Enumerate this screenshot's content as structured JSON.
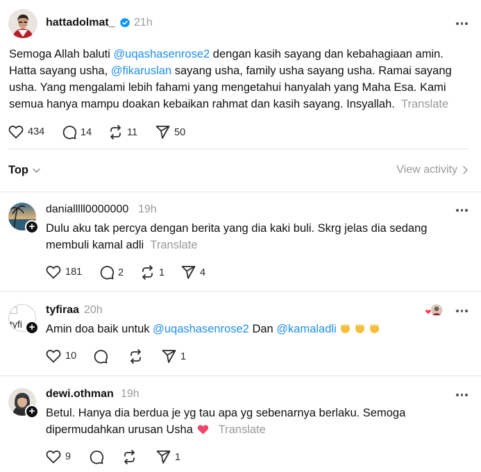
{
  "main_post": {
    "username": "hattadolmat_",
    "time": "21h",
    "text_a": "Semoga Allah baluti ",
    "mention_a": "@uqashasenrose2",
    "text_b": " dengan kasih sayang dan kebahagiaan amin.",
    "text_c": "Hatta sayang usha, ",
    "mention_b": "@fikaruslan",
    "text_d": " sayang usha, family usha sayang usha. Ramai sayang",
    "text_e": "usha. Yang mengalami lebih fahami yang mengetahui hanyalah yang Maha Esa. Kami",
    "text_f": "semua hanya mampu doakan kebaikan rahmat dan kasih sayang. Insyallah.",
    "translate": "Translate",
    "likes": "434",
    "replies": "14",
    "reposts": "11",
    "shares": "50"
  },
  "sort_bar": {
    "label": "Top",
    "view_activity": "View activity"
  },
  "replies": [
    {
      "username": "danialllll0000000",
      "time": "19h",
      "line1": "Dulu aku tak percya dengan berita yang dia kaki buli. Skrg jelas dia sedang",
      "line2": "membuli kamal adli",
      "translate": "Translate",
      "likes": "181",
      "replies": "2",
      "reposts": "1",
      "shares": "4"
    },
    {
      "username": "tyfiraa",
      "time": "20h",
      "avatar_alt": "tyfi",
      "text_a": "Amin doa baik untuk ",
      "mention_a": "@uqashasenrose2",
      "text_b": " Dan ",
      "mention_b": "@kamaladli",
      "likes": "10",
      "shares": "1"
    },
    {
      "username": "dewi.othman",
      "time": "19h",
      "line1": "Betul. Hanya dia berdua je yg tau apa yg sebenarnya berlaku. Semoga",
      "line2": "dipermudahkan urusan Usha",
      "translate": "Translate",
      "likes": "9",
      "shares": "1"
    }
  ],
  "colors": {
    "mention": "#1d8ff0",
    "muted": "#999999",
    "divider": "#e5e5e5",
    "heart_emoji": "#f0446b",
    "verified": "#0095f6"
  },
  "icons": {
    "like": "heart-icon",
    "reply": "comment-icon",
    "repost": "repost-icon",
    "share": "send-icon",
    "more": "more-icon",
    "verified": "verified-badge-icon",
    "follow": "plus-icon"
  }
}
